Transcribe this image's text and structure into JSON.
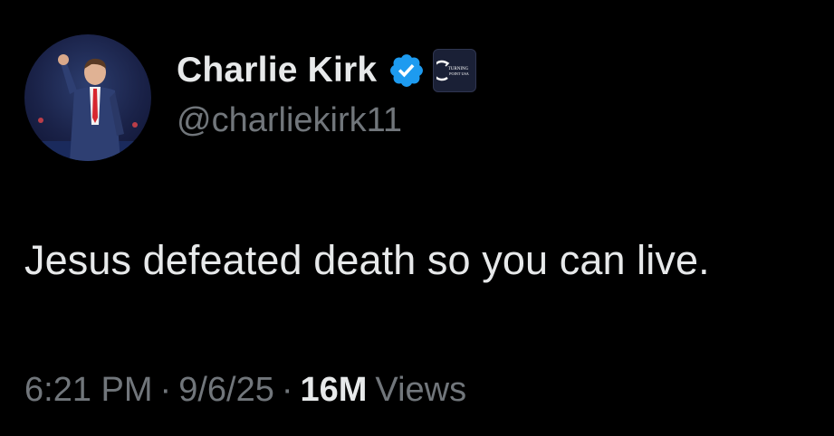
{
  "author": {
    "display_name": "Charlie Kirk",
    "handle": "@charliekirk11",
    "avatar_icon": "profile-photo",
    "verified_icon": "verified-check-icon",
    "verified_color": "#1d9bf0",
    "affiliate_icon": "affiliate-logo-icon",
    "affiliate_logo_text": [
      "TURNING",
      "POINT USA"
    ]
  },
  "tweet": {
    "text": "Jesus defeated death so you can live."
  },
  "meta": {
    "time": "6:21 PM",
    "separator": "·",
    "date": "9/6/25",
    "views_count": "16M",
    "views_label": "Views"
  },
  "colors": {
    "background": "#000000",
    "primary_text": "#e7e9ea",
    "secondary_text": "#71767b"
  }
}
